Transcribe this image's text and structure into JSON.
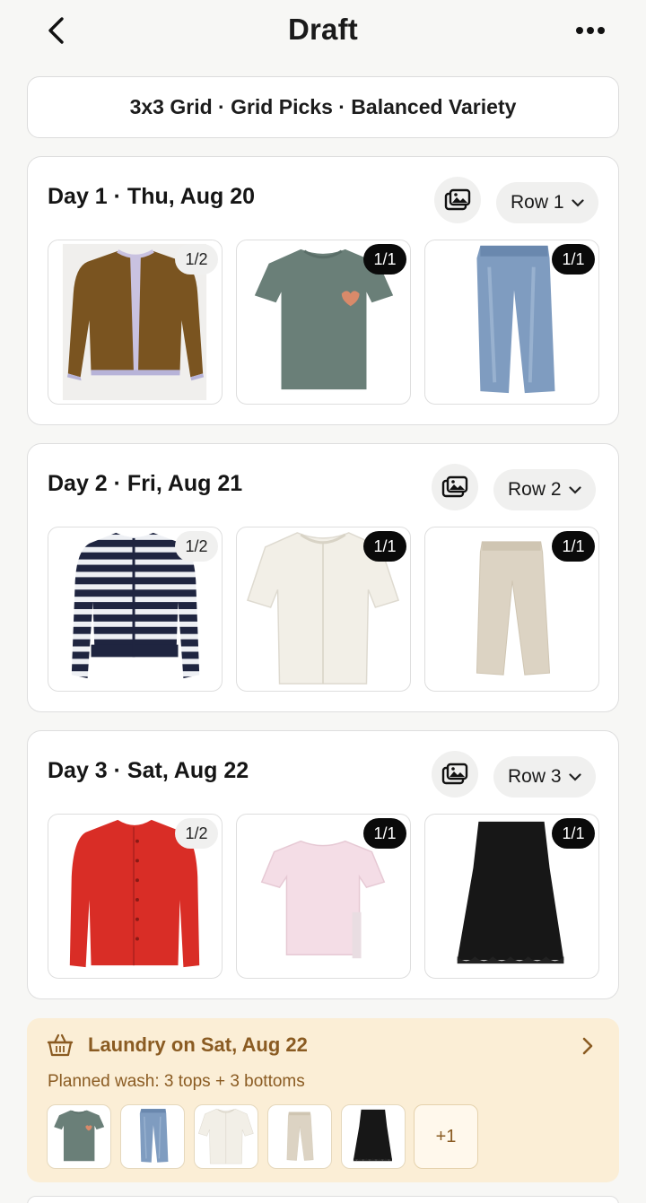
{
  "header": {
    "title": "Draft"
  },
  "summary": "3x3 Grid · Grid Picks · Balanced Variety",
  "days": [
    {
      "title": "Day 1 · Thu, Aug 20",
      "row_label": "Row 1",
      "items": [
        {
          "name": "brown-cardigan",
          "badge": "1/2"
        },
        {
          "name": "green-tshirt",
          "badge": "1/1"
        },
        {
          "name": "blue-jeans",
          "badge": "1/1"
        }
      ]
    },
    {
      "title": "Day 2 · Fri, Aug 21",
      "row_label": "Row 2",
      "items": [
        {
          "name": "navy-striped-cardigan",
          "badge": "1/2"
        },
        {
          "name": "white-knit-top",
          "badge": "1/1"
        },
        {
          "name": "beige-chinos",
          "badge": "1/1"
        }
      ]
    },
    {
      "title": "Day 3 · Sat, Aug 22",
      "row_label": "Row 3",
      "items": [
        {
          "name": "red-cardigan",
          "badge": "1/2"
        },
        {
          "name": "pink-tshirt",
          "badge": "1/1"
        },
        {
          "name": "black-skirt",
          "badge": "1/1"
        }
      ]
    }
  ],
  "laundry": {
    "title": "Laundry on Sat, Aug 22",
    "subtitle": "Planned wash: 3 tops + 3 bottoms",
    "more_label": "+1",
    "accent": "#8a5b22",
    "background": "#fbeed6"
  },
  "icons": [
    "chevron-left-icon",
    "more-dots-icon",
    "photos-icon",
    "chevron-down-icon",
    "laundry-basket-icon",
    "chevron-right-icon"
  ]
}
